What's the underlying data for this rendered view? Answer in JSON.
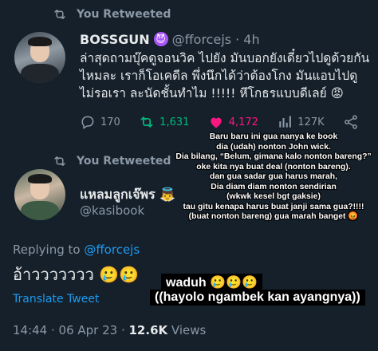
{
  "retweet_label": "You Retweeted",
  "quoted_tweet": {
    "name": "BOSSGUN",
    "badge_emoji": "😈",
    "handle": "@fforcejs",
    "time": "· 4h",
    "text": "ล่าสุดถามบุ๊คดูจอนวิค ไปยัง มันบอกยังเดี๋ยวไปดูด้วยกันไหมละ เราก็โอเคดีล พึ่งนึกได้ว่าต้องโกง มันแอบไปดูไม่รอเรา ละนัดชั้นทำไม !!!!! หึโกธรแบบดีเลย์ 😡",
    "actions": {
      "replies": "170",
      "retweets": "1,631",
      "likes": "4,172",
      "views": "127K"
    },
    "icons": [
      "reply-icon",
      "retweet-icon",
      "heart-icon",
      "views-icon",
      "share-icon"
    ]
  },
  "reply_tweet": {
    "name": "แหลมลูกเจ๊พร 👼",
    "handle": "@kasibook",
    "replying_prefix": "Replying to ",
    "replying_to": "@fforcejs",
    "text": "อ้าววววววว 🥲🥲",
    "translate_label": "Translate Tweet",
    "timestamp": "14:44 · 06 Apr 23 · ",
    "views_count": "12.6K",
    "views_label": " Views"
  },
  "overlay_caption": {
    "lines": [
      "Baru baru ini gua nanya ke book",
      "dia (udah) nonton John wick.",
      "Dia bilang, “Belum, gimana kalo nonton bareng?”",
      "oke kita nya buat deal (nonton bareng).",
      "dan gua sadar gua harus marah,",
      "Dia diam diam nonton sendirian",
      "(wkwk kesel bgt gaksie)",
      "tau gitu kenapa harus buat janji sama gua?!!!!",
      "(buat nonton bareng) gua marah banget 😡"
    ],
    "bottom_1": "waduh 🥲🥲🥲",
    "bottom_2": "((hayolo ngambek kan ayangnya))"
  },
  "colors": {
    "background": "#15202b",
    "secondary_text": "#8b98a5",
    "accent": "#1d9bf0",
    "retweet_green": "#00ba7c",
    "like_pink": "#f91880"
  }
}
